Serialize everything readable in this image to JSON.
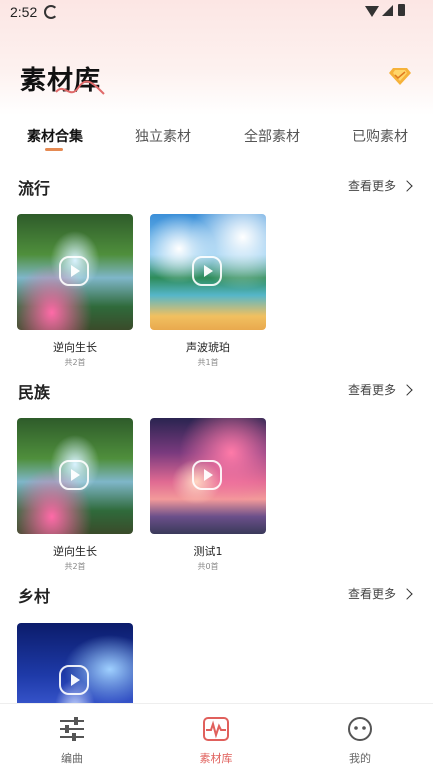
{
  "status_bar": {
    "time": "2:52"
  },
  "header": {
    "title": "素材库",
    "vip_icon": "diamond-icon"
  },
  "tabs": [
    {
      "label": "素材合集",
      "active": true
    },
    {
      "label": "独立素材",
      "active": false
    },
    {
      "label": "全部素材",
      "active": false
    },
    {
      "label": "已购素材",
      "active": false
    }
  ],
  "sections": [
    {
      "title": "流行",
      "see_more": "查看更多",
      "items": [
        {
          "title": "逆向生长",
          "count": "共2首",
          "image": "forest-waterfall"
        },
        {
          "title": "声波琥珀",
          "count": "共1首",
          "image": "beach-clouds"
        }
      ]
    },
    {
      "title": "民族",
      "see_more": "查看更多",
      "items": [
        {
          "title": "逆向生长",
          "count": "共2首",
          "image": "forest-waterfall"
        },
        {
          "title": "测试1",
          "count": "共0首",
          "image": "sunset-beach"
        }
      ]
    },
    {
      "title": "乡村",
      "see_more": "查看更多",
      "items": [
        {
          "title": "",
          "count": "",
          "image": "night-forest"
        }
      ]
    }
  ],
  "bottom_nav": [
    {
      "label": "编曲",
      "icon": "sliders-icon",
      "active": false
    },
    {
      "label": "素材库",
      "icon": "waveform-icon",
      "active": true
    },
    {
      "label": "我的",
      "icon": "face-icon",
      "active": false
    }
  ],
  "colors": {
    "accent": "#e58a52",
    "nav_active": "#e0605c"
  }
}
